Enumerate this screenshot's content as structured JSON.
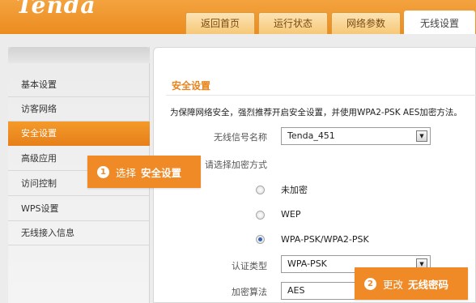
{
  "brand": {
    "logo_text": "Tenda"
  },
  "nav": {
    "tabs": [
      {
        "label": "返回首页"
      },
      {
        "label": "运行状态"
      },
      {
        "label": "网络参数"
      },
      {
        "label": "无线设置"
      }
    ]
  },
  "sidebar": {
    "items": [
      {
        "label": "基本设置"
      },
      {
        "label": "访客网络"
      },
      {
        "label": "安全设置"
      },
      {
        "label": "高级应用"
      },
      {
        "label": "访问控制"
      },
      {
        "label": "WPS设置"
      },
      {
        "label": "无线接入信息"
      }
    ]
  },
  "content": {
    "title": "安全设置",
    "intro": "为保障网络安全，强烈推荐开启安全设置，并使用WPA2-PSK AES加密方法。",
    "ssid_label": "无线信号名称",
    "ssid_value": "Tenda_451",
    "encrypt_label": "请选择加密方式",
    "options": [
      {
        "label": "未加密"
      },
      {
        "label": "WEP"
      },
      {
        "label": "WPA-PSK/WPA2-PSK"
      }
    ],
    "auth_label": "认证类型",
    "auth_value": "WPA-PSK",
    "cipher_label": "加密算法",
    "cipher_value": "AES"
  },
  "callouts": {
    "step1": {
      "num": "1",
      "text": "选择",
      "bold": "安全设置"
    },
    "step2": {
      "num": "2",
      "text": "更改",
      "bold": "无线密码"
    }
  },
  "colors": {
    "accent": "#ef8a27",
    "header_orange": "#ec8c1f",
    "title_orange": "#e8841c"
  }
}
